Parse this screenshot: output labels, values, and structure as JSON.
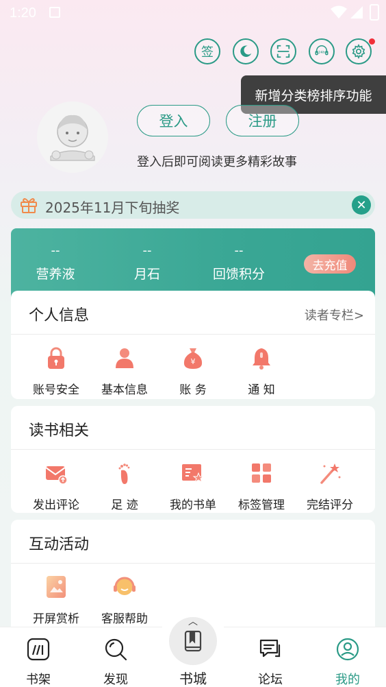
{
  "status_bar": {
    "time": "1:20"
  },
  "top_icons": [
    {
      "name": "sign-in-icon",
      "glyph": "签"
    },
    {
      "name": "night-mode-icon"
    },
    {
      "name": "scan-icon"
    },
    {
      "name": "customer-service-icon",
      "glyph": "24h"
    },
    {
      "name": "settings-icon"
    }
  ],
  "tooltip": {
    "text": "新增分类榜排序功能"
  },
  "auth": {
    "login_label": "登入",
    "register_label": "注册",
    "hint": "登入后即可阅读更多精彩故事"
  },
  "banner": {
    "text": "2025年11月下旬抽奖"
  },
  "wallet": {
    "items": [
      {
        "value": "--",
        "label": "营养液"
      },
      {
        "value": "--",
        "label": "月石"
      },
      {
        "value": "--",
        "label": "回馈积分"
      }
    ],
    "recharge_label": "去充值"
  },
  "personal": {
    "title": "个人信息",
    "more": "读者专栏>",
    "items": [
      {
        "label": "账号安全",
        "icon": "lock-icon"
      },
      {
        "label": "基本信息",
        "icon": "user-icon"
      },
      {
        "label": "账  务",
        "icon": "money-bag-icon"
      },
      {
        "label": "通  知",
        "icon": "bell-icon"
      }
    ]
  },
  "reading": {
    "title": "读书相关",
    "items": [
      {
        "label": "发出评论",
        "icon": "comment-envelope-icon"
      },
      {
        "label": "足  迹",
        "icon": "footprint-icon"
      },
      {
        "label": "我的书单",
        "icon": "booklist-icon"
      },
      {
        "label": "标签管理",
        "icon": "tags-grid-icon"
      },
      {
        "label": "完结评分",
        "icon": "magic-wand-icon"
      }
    ]
  },
  "activities": {
    "title": "互动活动",
    "items": [
      {
        "label": "开屏赏析",
        "icon": "image-icon"
      },
      {
        "label": "客服帮助",
        "icon": "headset-icon"
      }
    ]
  },
  "bottom_nav": {
    "items": [
      {
        "label": "书架",
        "icon": "bookshelf-icon"
      },
      {
        "label": "发现",
        "icon": "discover-icon"
      },
      {
        "label": "书城",
        "icon": "bookstore-icon"
      },
      {
        "label": "论坛",
        "icon": "forum-icon"
      },
      {
        "label": "我的",
        "icon": "profile-icon"
      }
    ],
    "active": "我的",
    "active_color": "#2a9a86"
  },
  "colors": {
    "accent": "#2a9a86",
    "wallet": "#3aa795",
    "notify": "#f0303a"
  }
}
